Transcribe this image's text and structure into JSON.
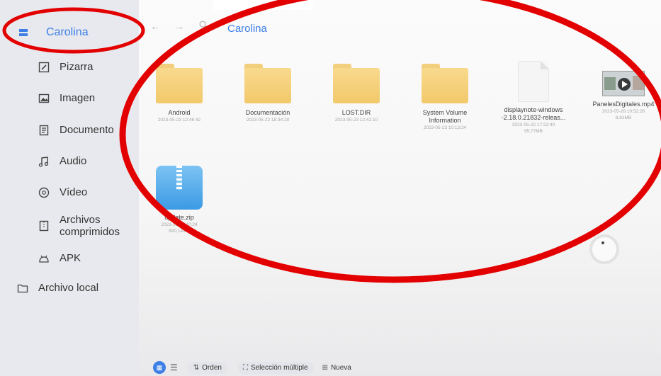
{
  "sidebar": {
    "active": "Carolina",
    "items": [
      {
        "label": "Pizarra",
        "icon": "whiteboard-icon"
      },
      {
        "label": "Imagen",
        "icon": "image-icon"
      },
      {
        "label": "Documento",
        "icon": "document-icon"
      },
      {
        "label": "Audio",
        "icon": "music-icon"
      },
      {
        "label": "Vídeo",
        "icon": "video-icon"
      },
      {
        "label": "Archivos\ncomprimidos",
        "icon": "archive-icon"
      },
      {
        "label": "APK",
        "icon": "apk-icon"
      }
    ],
    "local": "Archivo local"
  },
  "toolbar": {
    "back": "←",
    "forward": "→",
    "path_title": "Carolina"
  },
  "files": [
    {
      "name": "Android",
      "date": "2023-05-23  12:46:42",
      "size": "",
      "type": "folder"
    },
    {
      "name": "Documentación",
      "date": "2023-05-22  18:34:28",
      "size": "",
      "type": "folder"
    },
    {
      "name": "LOST.DIR",
      "date": "2023-05-23  12:41:10",
      "size": "",
      "type": "folder"
    },
    {
      "name": "System Volume\nInformation",
      "date": "2023-05-23  10:13:24",
      "size": "",
      "type": "folder"
    },
    {
      "name": "displaynote-windows\n-2.18.0.21832-releas...",
      "date": "2023-05-22  17:22:40",
      "size": "95,77MB",
      "type": "document"
    },
    {
      "name": "PanelesDigitales.mp4",
      "date": "2023-05-28  10:52:28",
      "size": "8,81MB",
      "type": "video"
    },
    {
      "name": "update.zip",
      "date": "2023-05-23  10:24",
      "size": "990,14MB",
      "type": "zip"
    }
  ],
  "bottombar": {
    "sort": "Orden",
    "multi": "Selección múltiple",
    "new": "Nueva"
  },
  "colors": {
    "accent": "#3d7fe6",
    "annotation": "#e30000"
  }
}
